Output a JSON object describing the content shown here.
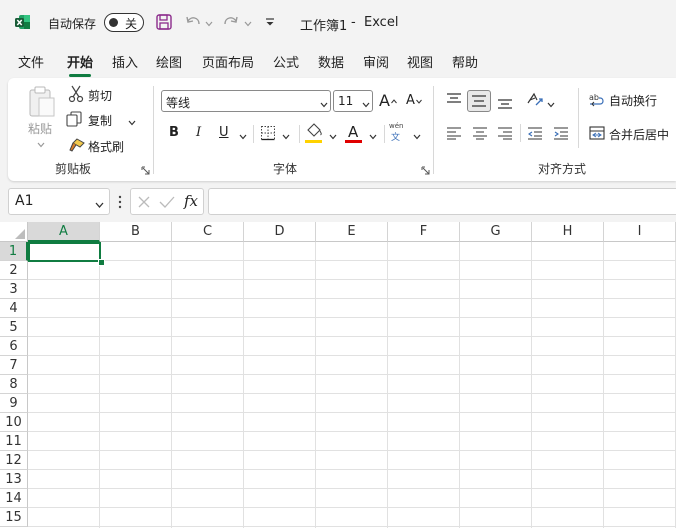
{
  "titlebar": {
    "autosave_label": "自动保存",
    "autosave_state": "关",
    "doc_title": "工作簿1",
    "separator": "-",
    "app_name": "Excel"
  },
  "menu": {
    "tabs": [
      "文件",
      "开始",
      "插入",
      "绘图",
      "页面布局",
      "公式",
      "数据",
      "审阅",
      "视图",
      "帮助"
    ],
    "active": "开始"
  },
  "clipboard": {
    "paste": "粘贴",
    "cut": "剪切",
    "copy": "复制",
    "format_painter": "格式刷",
    "group_label": "剪贴板"
  },
  "font": {
    "font_name": "等线",
    "font_size": "11",
    "bold": "B",
    "italic": "I",
    "underline": "U",
    "font_color_letter": "A",
    "phonetic_top": "wén",
    "phonetic_bottom": "文",
    "grow": "A",
    "shrink": "A",
    "group_label": "字体",
    "highlight_color": "#ffd200",
    "font_color": "#e00000"
  },
  "alignment": {
    "wrap_text": "自动换行",
    "merge_center": "合并后居中",
    "group_label": "对齐方式"
  },
  "formula_bar": {
    "name_box": "A1",
    "fx": "fx",
    "formula": ""
  },
  "sheet": {
    "columns": [
      "A",
      "B",
      "C",
      "D",
      "E",
      "F",
      "G",
      "H",
      "I"
    ],
    "rows": [
      "1",
      "2",
      "3",
      "4",
      "5",
      "6",
      "7",
      "8",
      "9",
      "10",
      "11",
      "12",
      "13",
      "14",
      "15"
    ],
    "selected": "A1",
    "accent": "#107c41"
  }
}
